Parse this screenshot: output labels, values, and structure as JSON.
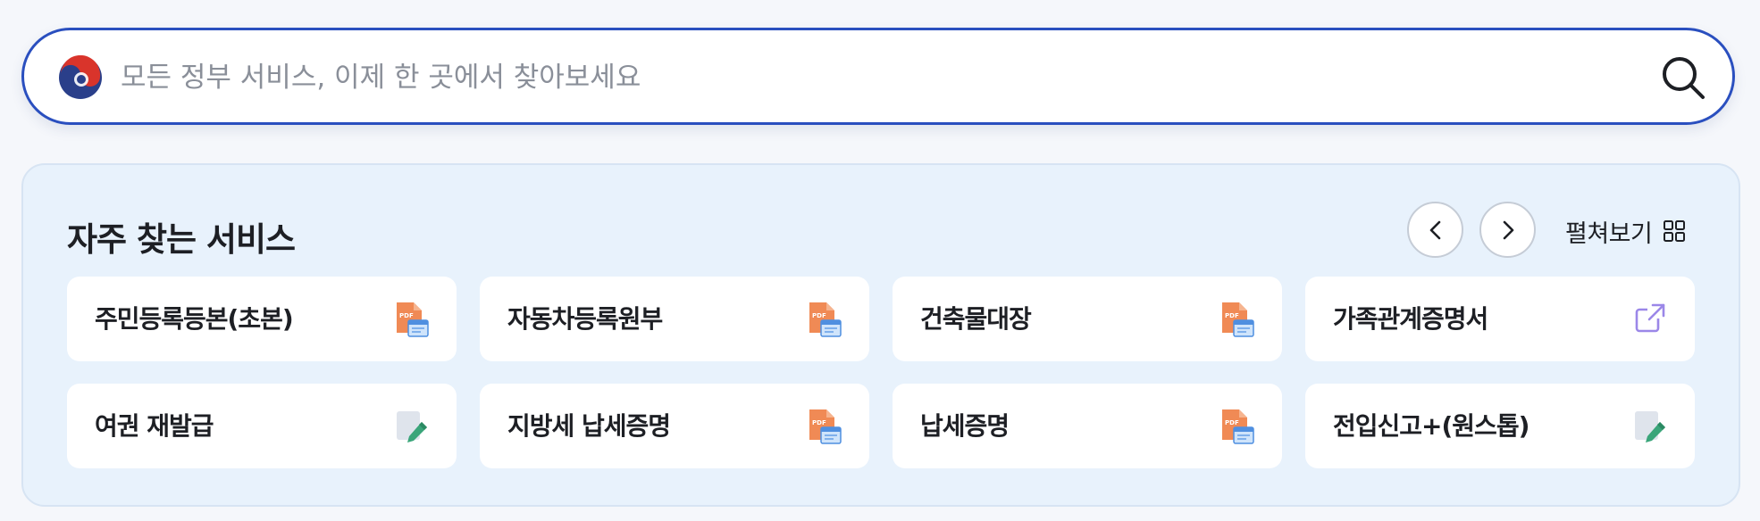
{
  "search": {
    "placeholder": "모든 정부 서비스, 이제 한 곳에서 찾아보세요",
    "value": "",
    "emblem_icon": "korea-taegeuk-emblem-icon",
    "button_icon": "search-icon"
  },
  "frequent": {
    "title": "자주 찾는 서비스",
    "prev_icon": "chevron-left-icon",
    "next_icon": "chevron-right-icon",
    "expand_label": "펼쳐보기",
    "expand_icon": "grid-icon",
    "items": [
      {
        "label": "주민등록등본(초본)",
        "icon": "pdf-document-icon"
      },
      {
        "label": "자동차등록원부",
        "icon": "pdf-document-icon"
      },
      {
        "label": "건축물대장",
        "icon": "pdf-document-icon"
      },
      {
        "label": "가족관계증명서",
        "icon": "external-link-icon"
      },
      {
        "label": "여권 재발급",
        "icon": "edit-form-icon"
      },
      {
        "label": "지방세 납세증명",
        "icon": "pdf-document-icon"
      },
      {
        "label": "납세증명",
        "icon": "pdf-document-icon"
      },
      {
        "label": "전입신고+(원스톱)",
        "icon": "edit-form-icon"
      }
    ]
  },
  "colors": {
    "search_border": "#2a4fbf",
    "panel_background": "#e8f2fc",
    "card_background": "#ffffff",
    "pdf_icon": "#f08a55",
    "external_link_icon": "#9b87e8",
    "edit_icon": "#3aa57a"
  }
}
